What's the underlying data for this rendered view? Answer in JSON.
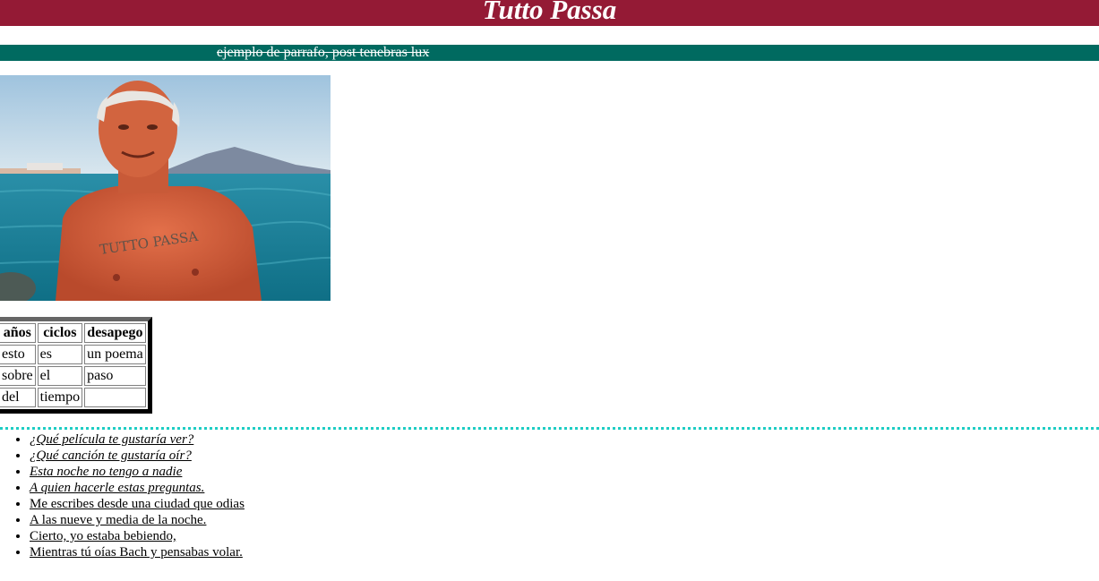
{
  "header": {
    "title": "Tutto Passa"
  },
  "subtitle": {
    "text": "ejemplo de parrafo, post tenebras lux"
  },
  "photo": {
    "tattoo_text": "TUTTO PASSA"
  },
  "table": {
    "headers": [
      "años",
      "ciclos",
      "desapego"
    ],
    "rows": [
      [
        "esto",
        "es",
        "un poema"
      ],
      [
        "sobre",
        "el",
        "paso"
      ],
      [
        "del",
        "tiempo",
        ""
      ]
    ]
  },
  "links": [
    {
      "text": "¿Qué película te gustaría ver?",
      "italic": true
    },
    {
      "text": "¿Qué canción te gustaría oír?",
      "italic": true
    },
    {
      "text": "Esta noche no tengo a nadie",
      "italic": true
    },
    {
      "text": "A quien hacerle estas preguntas.",
      "italic": true
    },
    {
      "text": "Me escribes desde una ciudad que odias",
      "italic": false
    },
    {
      "text": "A las nueve y media de la noche.",
      "italic": false
    },
    {
      "text": "Cierto, yo estaba bebiendo,",
      "italic": false
    },
    {
      "text": "Mientras tú oías Bach y pensabas volar.",
      "italic": false
    }
  ],
  "colors": {
    "header_bg": "#941a35",
    "subtitle_bg": "#006a60",
    "divider": "#1ecdc4"
  }
}
